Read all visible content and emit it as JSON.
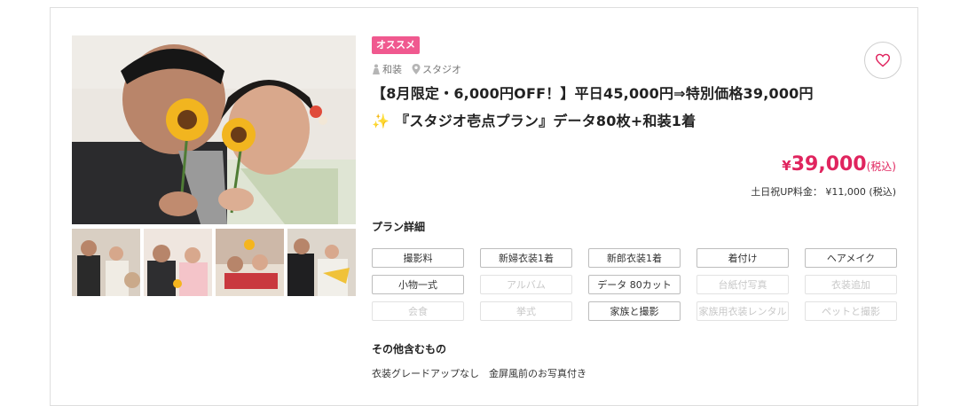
{
  "plan": {
    "badge": "オススメ",
    "tags": [
      {
        "icon": "kimono-icon",
        "label": "和装"
      },
      {
        "icon": "location-pin-icon",
        "label": "スタジオ"
      }
    ],
    "title_line1": "【8月限定・6,000円OFF！】平日45,000円⇒特別価格39,000円",
    "title_line2_icon": "✨",
    "title_line2": "『スタジオ壱点プラン』データ80枚+和装1着",
    "price": {
      "currency": "¥",
      "value": "39,000",
      "tax": "(税込)"
    },
    "weekend_fee": "土日祝UP料金： ¥11,000 (税込)",
    "details_title": "プラン詳細",
    "details": [
      {
        "label": "撮影料",
        "included": true
      },
      {
        "label": "新婦衣装1着",
        "included": true
      },
      {
        "label": "新郎衣装1着",
        "included": true
      },
      {
        "label": "着付け",
        "included": true
      },
      {
        "label": "ヘアメイク",
        "included": true
      },
      {
        "label": "小物一式",
        "included": true
      },
      {
        "label": "アルバム",
        "included": false
      },
      {
        "label": "データ 80カット",
        "included": true
      },
      {
        "label": "台紙付写真",
        "included": false
      },
      {
        "label": "衣装追加",
        "included": false
      },
      {
        "label": "会食",
        "included": false
      },
      {
        "label": "挙式",
        "included": false
      },
      {
        "label": "家族と撮影",
        "included": true
      },
      {
        "label": "家族用衣装レンタル",
        "included": false
      },
      {
        "label": "ペットと撮影",
        "included": false
      }
    ],
    "others_title": "その他含むもの",
    "others_text": "衣装グレードアップなし　金屏風前のお写真付き"
  },
  "colors": {
    "accent": "#e0245e",
    "badge": "#f0598f",
    "chip_border": "#bdbdbd",
    "chip_disabled": "#c8c8c8"
  }
}
